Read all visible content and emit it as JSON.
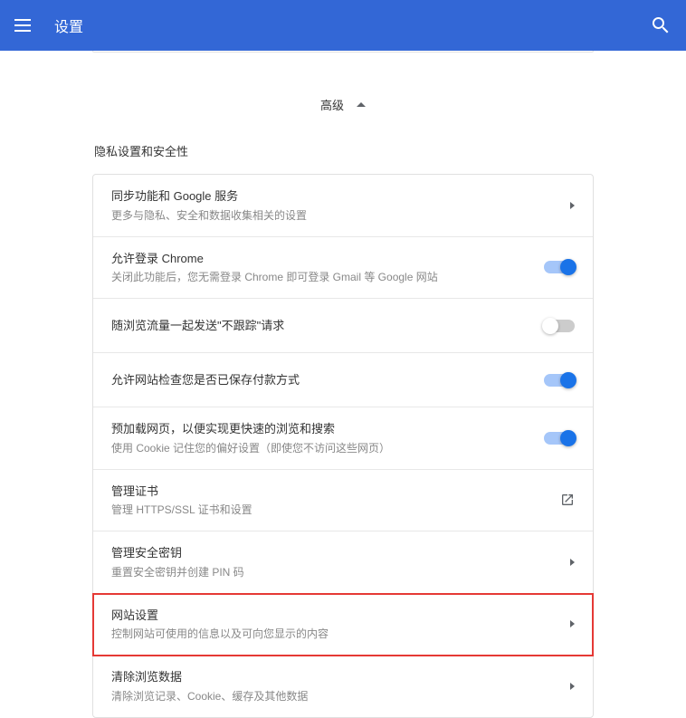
{
  "header": {
    "title": "设置"
  },
  "advanced": {
    "label": "高级"
  },
  "privacy": {
    "section_title": "隐私设置和安全性",
    "items": [
      {
        "title": "同步功能和 Google 服务",
        "sub": "更多与隐私、安全和数据收集相关的设置",
        "type": "arrow"
      },
      {
        "title": "允许登录 Chrome",
        "sub": "关闭此功能后，您无需登录 Chrome 即可登录 Gmail 等 Google 网站",
        "type": "toggle",
        "on": true
      },
      {
        "title": "随浏览流量一起发送\"不跟踪\"请求",
        "sub": "",
        "type": "toggle",
        "on": false
      },
      {
        "title": "允许网站检查您是否已保存付款方式",
        "sub": "",
        "type": "toggle",
        "on": true
      },
      {
        "title": "预加载网页，以便实现更快速的浏览和搜索",
        "sub": "使用 Cookie 记住您的偏好设置（即使您不访问这些网页）",
        "type": "toggle",
        "on": true
      },
      {
        "title": "管理证书",
        "sub": "管理 HTTPS/SSL 证书和设置",
        "type": "launch"
      },
      {
        "title": "管理安全密钥",
        "sub": "重置安全密钥并创建 PIN 码",
        "type": "arrow"
      },
      {
        "title": "网站设置",
        "sub": "控制网站可使用的信息以及可向您显示的内容",
        "type": "arrow",
        "highlighted": true
      },
      {
        "title": "清除浏览数据",
        "sub": "清除浏览记录、Cookie、缓存及其他数据",
        "type": "arrow"
      }
    ]
  }
}
